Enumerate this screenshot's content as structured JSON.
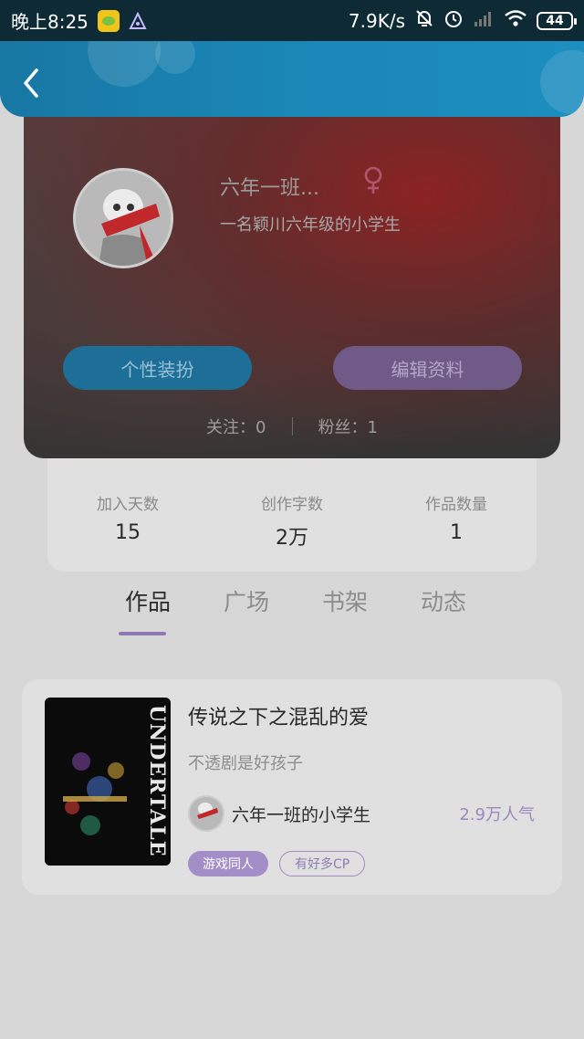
{
  "status_bar": {
    "time": "晚上8:25",
    "net_speed": "7.9K/s",
    "battery": "44"
  },
  "icons": {
    "back": "chevron-left-icon",
    "gender": "female-icon",
    "bell_muted": "bell-off-icon",
    "alarm": "alarm-icon",
    "signal": "signal-icon",
    "wifi": "wifi-icon"
  },
  "colors": {
    "header_blue": "#1a87b7",
    "accent_purple": "#8f78b4",
    "dress_button": "#1d6f98",
    "edit_button": "#6f5a88"
  },
  "profile": {
    "nickname": "六年一班...",
    "bio": "一名颖川六年级的小学生",
    "dress_button": "个性装扮",
    "edit_button": "编辑资料",
    "following": "关注：0",
    "followers": "粉丝：1"
  },
  "stats": [
    {
      "label": "加入天数",
      "value": "15"
    },
    {
      "label": "创作字数",
      "value": "2万"
    },
    {
      "label": "作品数量",
      "value": "1"
    }
  ],
  "tabs": [
    {
      "label": "作品",
      "active": true
    },
    {
      "label": "广场",
      "active": false
    },
    {
      "label": "书架",
      "active": false
    },
    {
      "label": "动态",
      "active": false
    }
  ],
  "works": [
    {
      "title": "传说之下之混乱的爱",
      "description": "不透剧是好孩子",
      "author": "六年一班的小学生",
      "popularity": "2.9万人气",
      "cover_text": "UNDERTALE",
      "tags": [
        "游戏同人",
        "有好多CP"
      ]
    }
  ]
}
